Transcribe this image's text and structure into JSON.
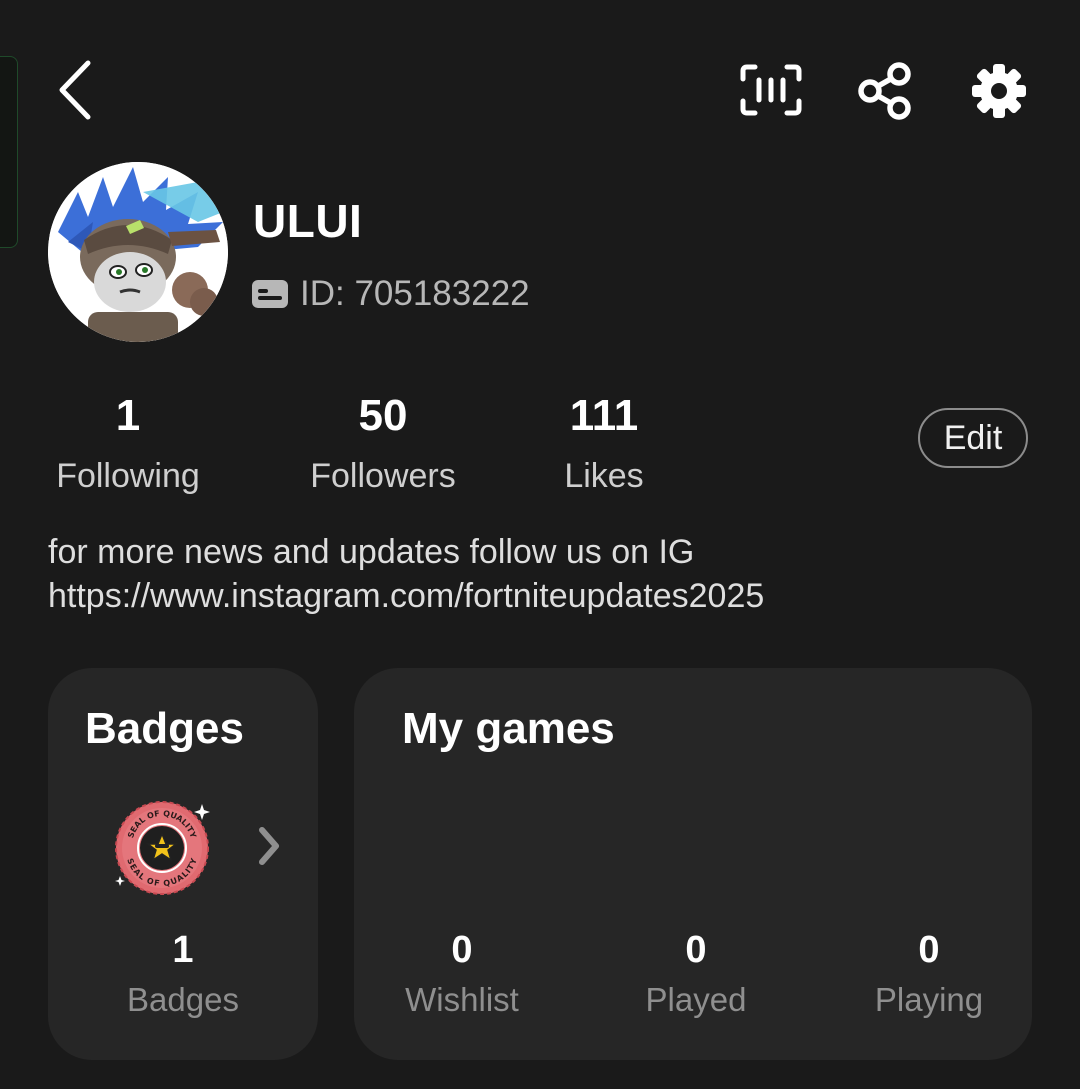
{
  "header": {
    "back_icon": "chevron-left-icon",
    "scan_icon": "scan-barcode-icon",
    "share_icon": "share-icon",
    "settings_icon": "gear-icon"
  },
  "profile": {
    "username": "ULUI",
    "id_label": "ID: 705183222",
    "id_icon": "id-card-icon",
    "bio_line1": "for more news and updates follow us on IG",
    "bio_link": "https://www.instagram.com/fortniteupdates2025"
  },
  "stats": {
    "following": {
      "value": "1",
      "label": "Following"
    },
    "followers": {
      "value": "50",
      "label": "Followers"
    },
    "likes": {
      "value": "111",
      "label": "Likes"
    }
  },
  "edit_label": "Edit",
  "badges_card": {
    "title": "Badges",
    "count": "1",
    "count_label": "Badges",
    "badge_text": "SEAL OF QUALITY"
  },
  "games_card": {
    "title": "My games",
    "wishlist": {
      "value": "0",
      "label": "Wishlist"
    },
    "played": {
      "value": "0",
      "label": "Played"
    },
    "playing": {
      "value": "0",
      "label": "Playing"
    }
  },
  "colors": {
    "background": "#1a1a1a",
    "card": "#262626",
    "muted_text": "#8f8f8f",
    "accent_green": "#1f4a2a"
  }
}
